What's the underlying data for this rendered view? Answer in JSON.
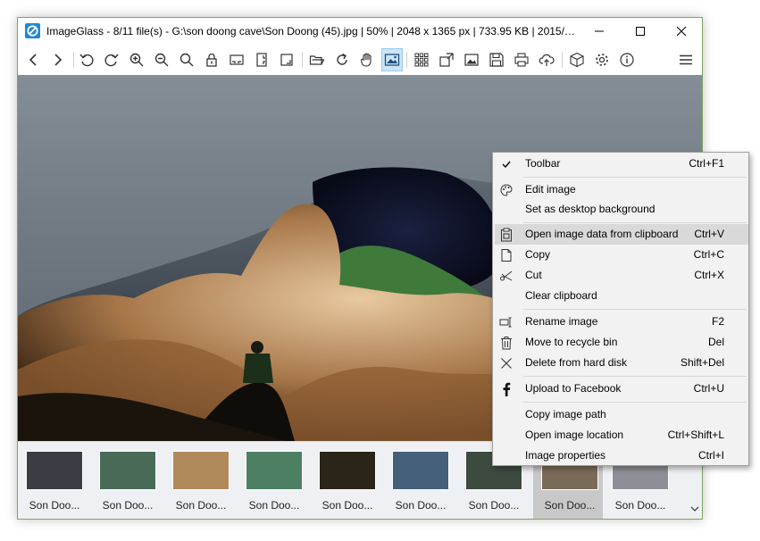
{
  "window": {
    "title": "ImageGlass - 8/11 file(s) - G:\\son doong cave\\Son Doong (45).jpg  |  50%  |  2048 x 1365 px  |  733.95 KB  |  2015/9...",
    "app_icon": "imageglass-logo-icon",
    "controls": [
      {
        "name": "minimize-icon"
      },
      {
        "name": "maximize-icon"
      },
      {
        "name": "close-icon"
      }
    ]
  },
  "toolbar": {
    "buttons": [
      "back-icon",
      "forward-icon",
      "rotate-left-icon",
      "rotate-right-icon",
      "zoom-in-icon",
      "zoom-out-icon",
      "actual-size-icon",
      "lock-zoom-icon",
      "fit-width-icon",
      "fit-height-icon",
      "scale-to-fit-icon",
      "open-folder-icon",
      "refresh-icon",
      "pan-hand-icon",
      "auto-zoom-image-icon",
      "thumbnail-grid-icon",
      "fullscreen-icon",
      "slideshow-icon",
      "save-icon",
      "print-icon",
      "upload-icon",
      "3d-object-icon",
      "settings-icon",
      "about-icon",
      "main-menu-icon"
    ],
    "active_button": "auto-zoom-image-icon"
  },
  "thumbnails": {
    "items": [
      {
        "label": "Son Doo...",
        "color": "#3a3d44"
      },
      {
        "label": "Son Doo...",
        "color": "#4a6a58"
      },
      {
        "label": "Son Doo...",
        "color": "#b08a5a"
      },
      {
        "label": "Son Doo...",
        "color": "#4d7f62"
      },
      {
        "label": "Son Doo...",
        "color": "#2b2418"
      },
      {
        "label": "Son Doo...",
        "color": "#44607a"
      },
      {
        "label": "Son Doo...",
        "color": "#3d4a3f"
      },
      {
        "label": "Son Doo...",
        "color": "#7a6b58"
      },
      {
        "label": "Son Doo...",
        "color": "#8d8f96"
      }
    ],
    "selected_index": 7
  },
  "context_menu": {
    "items": [
      {
        "label": "Toolbar",
        "shortcut": "Ctrl+F1",
        "icon": "check-icon"
      },
      {
        "label": "Edit image",
        "shortcut": "",
        "icon": "palette-icon"
      },
      {
        "label": "Set as desktop background",
        "shortcut": "",
        "icon": ""
      },
      {
        "label": "Open image data from clipboard",
        "shortcut": "Ctrl+V",
        "icon": "clipboard-icon"
      },
      {
        "label": "Copy",
        "shortcut": "Ctrl+C",
        "icon": "copy-icon"
      },
      {
        "label": "Cut",
        "shortcut": "Ctrl+X",
        "icon": "scissors-icon"
      },
      {
        "label": "Clear clipboard",
        "shortcut": "",
        "icon": ""
      },
      {
        "label": "Rename image",
        "shortcut": "F2",
        "icon": "rename-icon"
      },
      {
        "label": "Move to recycle bin",
        "shortcut": "Del",
        "icon": "recycle-bin-icon"
      },
      {
        "label": "Delete from hard disk",
        "shortcut": "Shift+Del",
        "icon": "delete-x-icon"
      },
      {
        "label": "Upload to Facebook",
        "shortcut": "Ctrl+U",
        "icon": "facebook-icon"
      },
      {
        "label": "Copy image path",
        "shortcut": "",
        "icon": ""
      },
      {
        "label": "Open image location",
        "shortcut": "Ctrl+Shift+L",
        "icon": ""
      },
      {
        "label": "Image properties",
        "shortcut": "Ctrl+I",
        "icon": ""
      }
    ],
    "highlighted_index": 3
  },
  "colors": {
    "window_border": "#7fa35e",
    "menu_bg": "#f2f2f2",
    "menu_highlight": "#d9d9d9",
    "toolbar_active": "#cce4f7",
    "thumb_selected": "#c8c8c8",
    "thumbbar_bg": "#eef0f4"
  }
}
